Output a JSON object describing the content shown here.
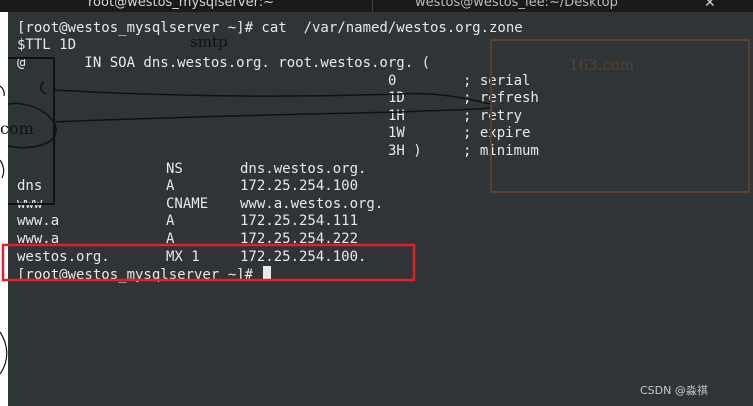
{
  "tabs": [
    {
      "label": "root@westos_mysqlserver:~"
    },
    {
      "label": "westos@westos_lee:~/Desktop"
    }
  ],
  "close_glyph": "✕",
  "terminal": {
    "prompt_cmd": "[root@westos_mysqlserver ~]# cat  /var/named/westos.org.zone",
    "ttl": "$TTL 1D",
    "soa": "@       IN SOA dns.westos.org. root.westos.org. (",
    "soa_fields": [
      {
        "value": "0",
        "comment": "; serial"
      },
      {
        "value": "1D",
        "comment": "; refresh"
      },
      {
        "value": "1H",
        "comment": "; retry"
      },
      {
        "value": "1W",
        "comment": "; expire"
      },
      {
        "value": "3H )",
        "comment": "; minimum"
      }
    ],
    "records": [
      {
        "name": "",
        "type": "NS",
        "value": "dns.westos.org."
      },
      {
        "name": "dns",
        "type": "A",
        "value": "172.25.254.100"
      },
      {
        "name": "www",
        "type": "CNAME",
        "value": "www.a.westos.org."
      },
      {
        "name": "www.a",
        "type": "A",
        "value": "172.25.254.111"
      },
      {
        "name": "www.a",
        "type": "A",
        "value": "172.25.254.222"
      },
      {
        "name": "westos.org.",
        "type": "MX 1",
        "value": "172.25.254.100."
      }
    ],
    "prompt_end": "[root@westos_mysqlserver ~]# "
  },
  "annotations": {
    "smtp": "smtp",
    "domain_163": "163.com",
    "com_fragment": "com"
  },
  "watermark": "CSDN @淼祺",
  "colors": {
    "terminal_bg": "#2f3437",
    "terminal_text": "#e8e8e8",
    "highlight_box": "#e0202a",
    "annotation_box": "#5a4030"
  }
}
